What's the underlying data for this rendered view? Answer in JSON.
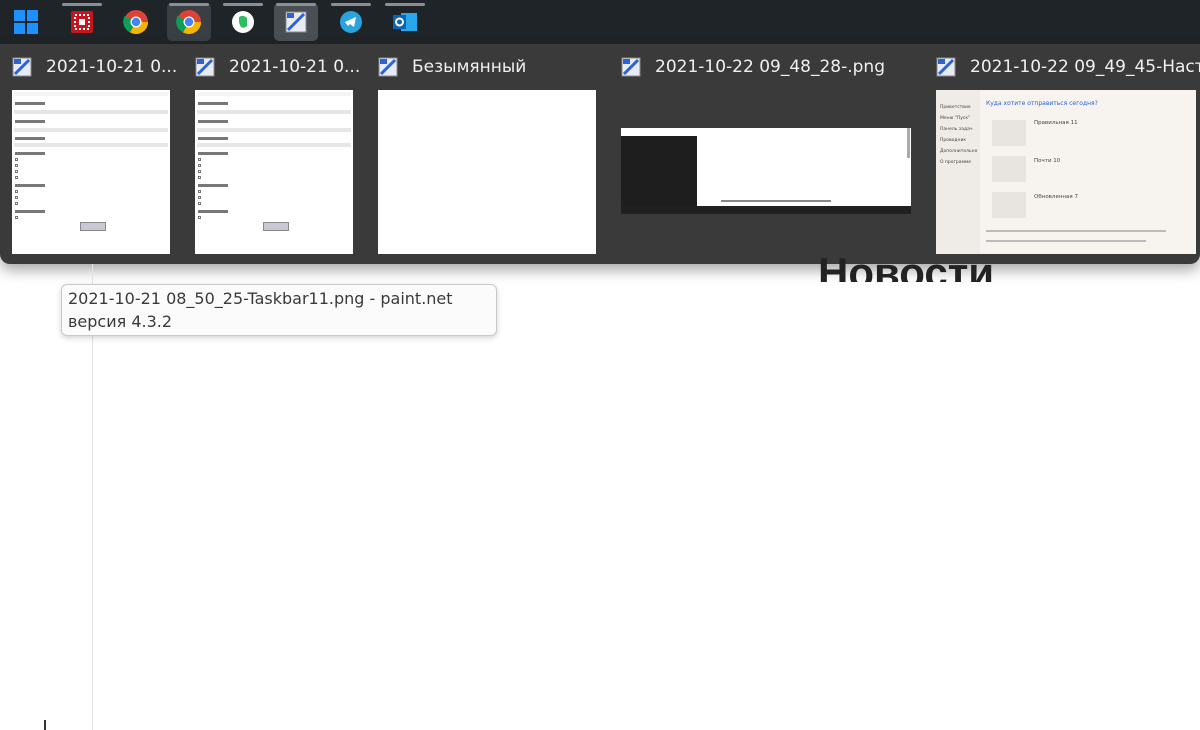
{
  "taskbar": {
    "apps": [
      {
        "name": "start",
        "icon": "windows-logo-icon"
      },
      {
        "name": "app-red",
        "icon": "red-app-icon"
      },
      {
        "name": "chrome-1",
        "icon": "chrome-icon"
      },
      {
        "name": "chrome-2",
        "icon": "chrome-icon"
      },
      {
        "name": "evernote",
        "icon": "evernote-icon"
      },
      {
        "name": "paint-net",
        "icon": "paint-net-icon"
      },
      {
        "name": "telegram",
        "icon": "telegram-icon"
      },
      {
        "name": "outlook",
        "icon": "outlook-icon"
      }
    ]
  },
  "flyout": {
    "thumbnails": [
      {
        "title": "2021-10-21 0..."
      },
      {
        "title": "2021-10-21 0..."
      },
      {
        "title": "Безымянный"
      },
      {
        "title": "2021-10-22 09_48_28-.png"
      },
      {
        "title": "2021-10-22 09_49_45-Наст..."
      }
    ],
    "preview5": {
      "heading": "Куда хотите отправиться сегодня?",
      "sidebar": [
        "Приветствие",
        "Меню \"Пуск\"",
        "Панель задач",
        "Проводник",
        "Дополнительно",
        "О программе"
      ],
      "options": [
        "Правильная 11",
        "Почти 10",
        "Обновленная 7"
      ]
    }
  },
  "page": {
    "heading": "Новости"
  },
  "tooltip": {
    "text": "2021-10-21 08_50_25-Taskbar11.png - paint.net версия 4.3.2"
  },
  "colors": {
    "taskbar_bg": "#1f2428",
    "flyout_bg": "#3a3a3a",
    "accent_blue": "#1e90ff"
  }
}
